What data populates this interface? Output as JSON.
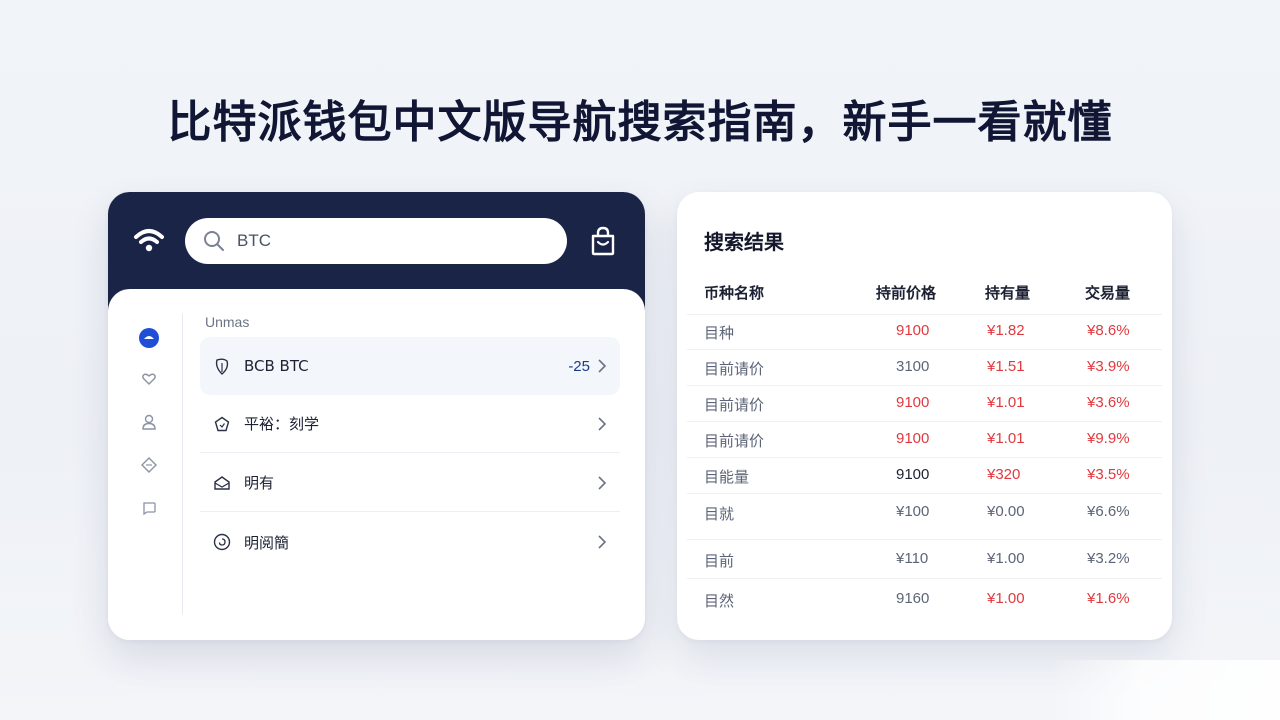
{
  "headline": "比特派钱包中文版导航搜索指南，新手一看就懂",
  "search": {
    "value": "BTC"
  },
  "sidebar": {
    "heading": "Unmas"
  },
  "list": {
    "items": [
      {
        "label": "BCB   BTC",
        "value": "-25"
      },
      {
        "label": "平裕：刻学",
        "value": ""
      },
      {
        "label": "明有",
        "value": ""
      },
      {
        "label": "明阅簡",
        "value": ""
      }
    ]
  },
  "results": {
    "title": "搜索结果",
    "columns": [
      "币种名称",
      "持前价格",
      "持有量",
      "交易量"
    ],
    "rows": [
      {
        "name": "目种",
        "price": "9100",
        "holding": "¥1.82",
        "volume": "¥8.6%"
      },
      {
        "name": "目前请价",
        "price": "3100",
        "holding": "¥1.51",
        "volume": "¥3.9%"
      },
      {
        "name": "目前请价",
        "price": "9100",
        "holding": "¥1.01",
        "volume": "¥3.6%"
      },
      {
        "name": "目前请价",
        "price": "9100",
        "holding": "¥1.01",
        "volume": "¥9.9%"
      },
      {
        "name": "目能量",
        "price": "9100",
        "holding": "¥320",
        "volume": "¥3.5%"
      },
      {
        "name": "目就",
        "price": "¥100",
        "holding": "¥0.00",
        "volume": "¥6.6%"
      },
      {
        "name": "目前",
        "price": "¥110",
        "holding": "¥1.00",
        "volume": "¥3.2%"
      },
      {
        "name": "目然",
        "price": "9160",
        "holding": "¥1.00",
        "volume": "¥1.6%"
      }
    ]
  },
  "colors": {
    "topbar": "#1a2447",
    "accent_blue": "#1f4fd6",
    "red": "#e0393e"
  },
  "icons": {
    "topbar_left": "wifi-icon",
    "search": "search-icon",
    "topbar_right": "bag-icon"
  }
}
